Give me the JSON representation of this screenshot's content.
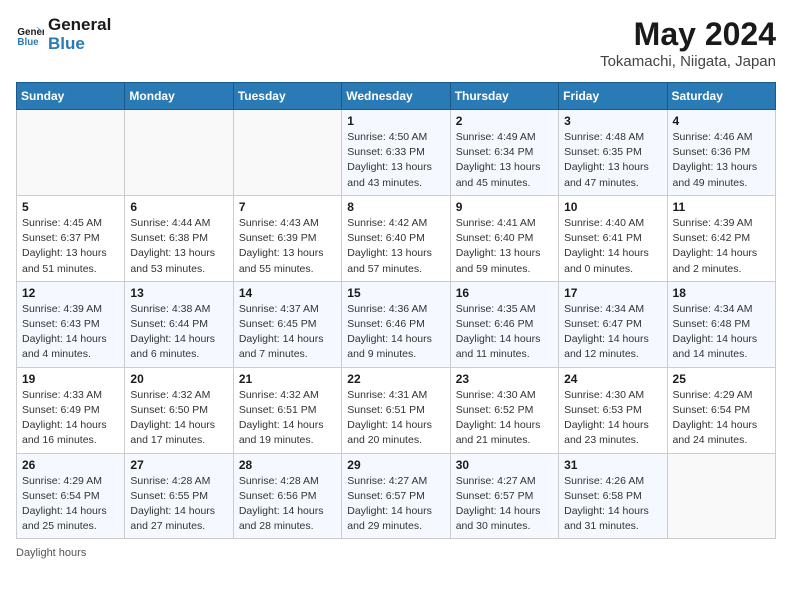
{
  "header": {
    "logo_line1": "General",
    "logo_line2": "Blue",
    "month_title": "May 2024",
    "location": "Tokamachi, Niigata, Japan"
  },
  "weekdays": [
    "Sunday",
    "Monday",
    "Tuesday",
    "Wednesday",
    "Thursday",
    "Friday",
    "Saturday"
  ],
  "weeks": [
    [
      {
        "day": "",
        "info": ""
      },
      {
        "day": "",
        "info": ""
      },
      {
        "day": "",
        "info": ""
      },
      {
        "day": "1",
        "info": "Sunrise: 4:50 AM\nSunset: 6:33 PM\nDaylight: 13 hours\nand 43 minutes."
      },
      {
        "day": "2",
        "info": "Sunrise: 4:49 AM\nSunset: 6:34 PM\nDaylight: 13 hours\nand 45 minutes."
      },
      {
        "day": "3",
        "info": "Sunrise: 4:48 AM\nSunset: 6:35 PM\nDaylight: 13 hours\nand 47 minutes."
      },
      {
        "day": "4",
        "info": "Sunrise: 4:46 AM\nSunset: 6:36 PM\nDaylight: 13 hours\nand 49 minutes."
      }
    ],
    [
      {
        "day": "5",
        "info": "Sunrise: 4:45 AM\nSunset: 6:37 PM\nDaylight: 13 hours\nand 51 minutes."
      },
      {
        "day": "6",
        "info": "Sunrise: 4:44 AM\nSunset: 6:38 PM\nDaylight: 13 hours\nand 53 minutes."
      },
      {
        "day": "7",
        "info": "Sunrise: 4:43 AM\nSunset: 6:39 PM\nDaylight: 13 hours\nand 55 minutes."
      },
      {
        "day": "8",
        "info": "Sunrise: 4:42 AM\nSunset: 6:40 PM\nDaylight: 13 hours\nand 57 minutes."
      },
      {
        "day": "9",
        "info": "Sunrise: 4:41 AM\nSunset: 6:40 PM\nDaylight: 13 hours\nand 59 minutes."
      },
      {
        "day": "10",
        "info": "Sunrise: 4:40 AM\nSunset: 6:41 PM\nDaylight: 14 hours\nand 0 minutes."
      },
      {
        "day": "11",
        "info": "Sunrise: 4:39 AM\nSunset: 6:42 PM\nDaylight: 14 hours\nand 2 minutes."
      }
    ],
    [
      {
        "day": "12",
        "info": "Sunrise: 4:39 AM\nSunset: 6:43 PM\nDaylight: 14 hours\nand 4 minutes."
      },
      {
        "day": "13",
        "info": "Sunrise: 4:38 AM\nSunset: 6:44 PM\nDaylight: 14 hours\nand 6 minutes."
      },
      {
        "day": "14",
        "info": "Sunrise: 4:37 AM\nSunset: 6:45 PM\nDaylight: 14 hours\nand 7 minutes."
      },
      {
        "day": "15",
        "info": "Sunrise: 4:36 AM\nSunset: 6:46 PM\nDaylight: 14 hours\nand 9 minutes."
      },
      {
        "day": "16",
        "info": "Sunrise: 4:35 AM\nSunset: 6:46 PM\nDaylight: 14 hours\nand 11 minutes."
      },
      {
        "day": "17",
        "info": "Sunrise: 4:34 AM\nSunset: 6:47 PM\nDaylight: 14 hours\nand 12 minutes."
      },
      {
        "day": "18",
        "info": "Sunrise: 4:34 AM\nSunset: 6:48 PM\nDaylight: 14 hours\nand 14 minutes."
      }
    ],
    [
      {
        "day": "19",
        "info": "Sunrise: 4:33 AM\nSunset: 6:49 PM\nDaylight: 14 hours\nand 16 minutes."
      },
      {
        "day": "20",
        "info": "Sunrise: 4:32 AM\nSunset: 6:50 PM\nDaylight: 14 hours\nand 17 minutes."
      },
      {
        "day": "21",
        "info": "Sunrise: 4:32 AM\nSunset: 6:51 PM\nDaylight: 14 hours\nand 19 minutes."
      },
      {
        "day": "22",
        "info": "Sunrise: 4:31 AM\nSunset: 6:51 PM\nDaylight: 14 hours\nand 20 minutes."
      },
      {
        "day": "23",
        "info": "Sunrise: 4:30 AM\nSunset: 6:52 PM\nDaylight: 14 hours\nand 21 minutes."
      },
      {
        "day": "24",
        "info": "Sunrise: 4:30 AM\nSunset: 6:53 PM\nDaylight: 14 hours\nand 23 minutes."
      },
      {
        "day": "25",
        "info": "Sunrise: 4:29 AM\nSunset: 6:54 PM\nDaylight: 14 hours\nand 24 minutes."
      }
    ],
    [
      {
        "day": "26",
        "info": "Sunrise: 4:29 AM\nSunset: 6:54 PM\nDaylight: 14 hours\nand 25 minutes."
      },
      {
        "day": "27",
        "info": "Sunrise: 4:28 AM\nSunset: 6:55 PM\nDaylight: 14 hours\nand 27 minutes."
      },
      {
        "day": "28",
        "info": "Sunrise: 4:28 AM\nSunset: 6:56 PM\nDaylight: 14 hours\nand 28 minutes."
      },
      {
        "day": "29",
        "info": "Sunrise: 4:27 AM\nSunset: 6:57 PM\nDaylight: 14 hours\nand 29 minutes."
      },
      {
        "day": "30",
        "info": "Sunrise: 4:27 AM\nSunset: 6:57 PM\nDaylight: 14 hours\nand 30 minutes."
      },
      {
        "day": "31",
        "info": "Sunrise: 4:26 AM\nSunset: 6:58 PM\nDaylight: 14 hours\nand 31 minutes."
      },
      {
        "day": "",
        "info": ""
      }
    ]
  ],
  "footer": {
    "daylight_label": "Daylight hours"
  }
}
